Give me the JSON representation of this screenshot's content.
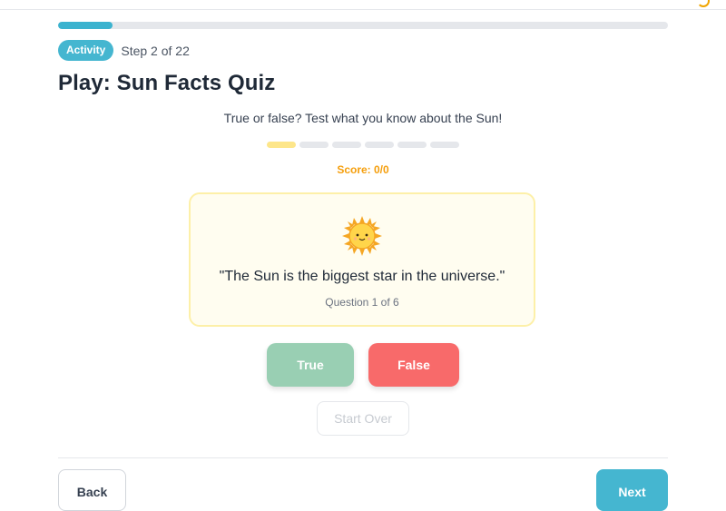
{
  "header": {
    "progress": {
      "current_step": 2,
      "total_steps": 22,
      "fill_fraction": 0.09
    },
    "badge": "Activity",
    "step_label": "Step 2 of 22",
    "title": "Play: Sun Facts Quiz"
  },
  "quiz": {
    "intro": "True or false? Test what you know about the Sun!",
    "question_dots": {
      "total": 6,
      "current": 1
    },
    "score": "Score: 0/0",
    "card": {
      "icon": "sun-icon",
      "statement": "\"The Sun is the biggest star in the universe.\"",
      "question_number": "Question 1 of 6"
    },
    "answers": {
      "true_label": "True",
      "false_label": "False"
    },
    "start_over_label": "Start Over"
  },
  "footer": {
    "back_label": "Back",
    "next_label": "Next"
  },
  "colors": {
    "accent": "#45b6d0",
    "true_button": "#99cfb3",
    "false_button": "#f86a6a",
    "score": "#f59e0b",
    "active_dot": "#fde68a",
    "card_border": "#fdf0a8"
  }
}
